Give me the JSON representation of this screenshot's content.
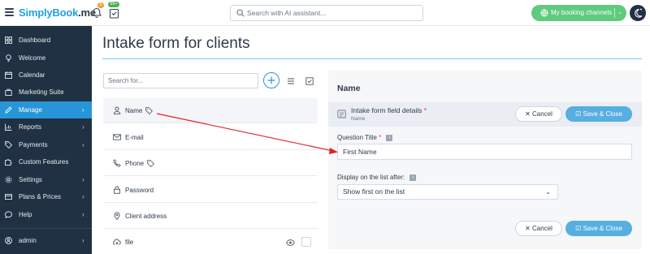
{
  "topbar": {
    "logo_main": "SimplyBook",
    "logo_suffix": ".me",
    "notification_badge": "5",
    "tasks_badge": "99+",
    "search_placeholder": "Search with AI assistant...",
    "booking_channels_label": "My booking channels"
  },
  "sidebar": {
    "items": [
      {
        "label": "Dashboard",
        "icon": "dashboard-icon",
        "has_chevron": false
      },
      {
        "label": "Welcome",
        "icon": "bulb-icon",
        "has_chevron": false
      },
      {
        "label": "Calendar",
        "icon": "calendar-icon",
        "has_chevron": false
      },
      {
        "label": "Marketing Suite",
        "icon": "bag-icon",
        "has_chevron": false
      },
      {
        "label": "Manage",
        "icon": "pencil-icon",
        "has_chevron": true,
        "active": true
      },
      {
        "label": "Reports",
        "icon": "chart-icon",
        "has_chevron": true
      },
      {
        "label": "Payments",
        "icon": "tag-icon",
        "has_chevron": true
      },
      {
        "label": "Custom Features",
        "icon": "puzzle-icon",
        "has_chevron": false
      },
      {
        "label": "Settings",
        "icon": "gear-icon",
        "has_chevron": true
      },
      {
        "label": "Plans & Prices",
        "icon": "card-icon",
        "has_chevron": true
      },
      {
        "label": "Help",
        "icon": "chat-icon",
        "has_chevron": true
      }
    ],
    "user": {
      "label": "admin",
      "icon": "user-icon"
    }
  },
  "page": {
    "title": "Intake form for clients"
  },
  "list": {
    "search_placeholder": "Search for...",
    "fields": [
      {
        "label": "Name",
        "icon": "person-icon",
        "tagged": true,
        "selected": true
      },
      {
        "label": "E-mail",
        "icon": "mail-icon",
        "tagged": false
      },
      {
        "label": "Phone",
        "icon": "phone-icon",
        "tagged": true
      },
      {
        "label": "Password",
        "icon": "lock-icon",
        "tagged": false
      },
      {
        "label": "Client address",
        "icon": "pin-icon",
        "tagged": false
      },
      {
        "label": "file",
        "icon": "cloud-upload-icon",
        "tagged": false
      }
    ]
  },
  "panel": {
    "title": "Name",
    "details_title": "Intake form field details",
    "details_required_mark": "*",
    "details_subtitle": "Name",
    "cancel_label": "Cancel",
    "save_label": "Save & Close",
    "question_title_label": "Question Title",
    "question_title_required_mark": "*",
    "question_title_value": "First Name",
    "display_after_label": "Display on the list after:",
    "display_after_value": "Show first on the list",
    "info_glyph": "i"
  },
  "colors": {
    "sidebar_bg": "#1f3142",
    "accent_blue": "#2796d8",
    "booking_green": "#5fcb7d",
    "arrow_red": "#e02424"
  }
}
